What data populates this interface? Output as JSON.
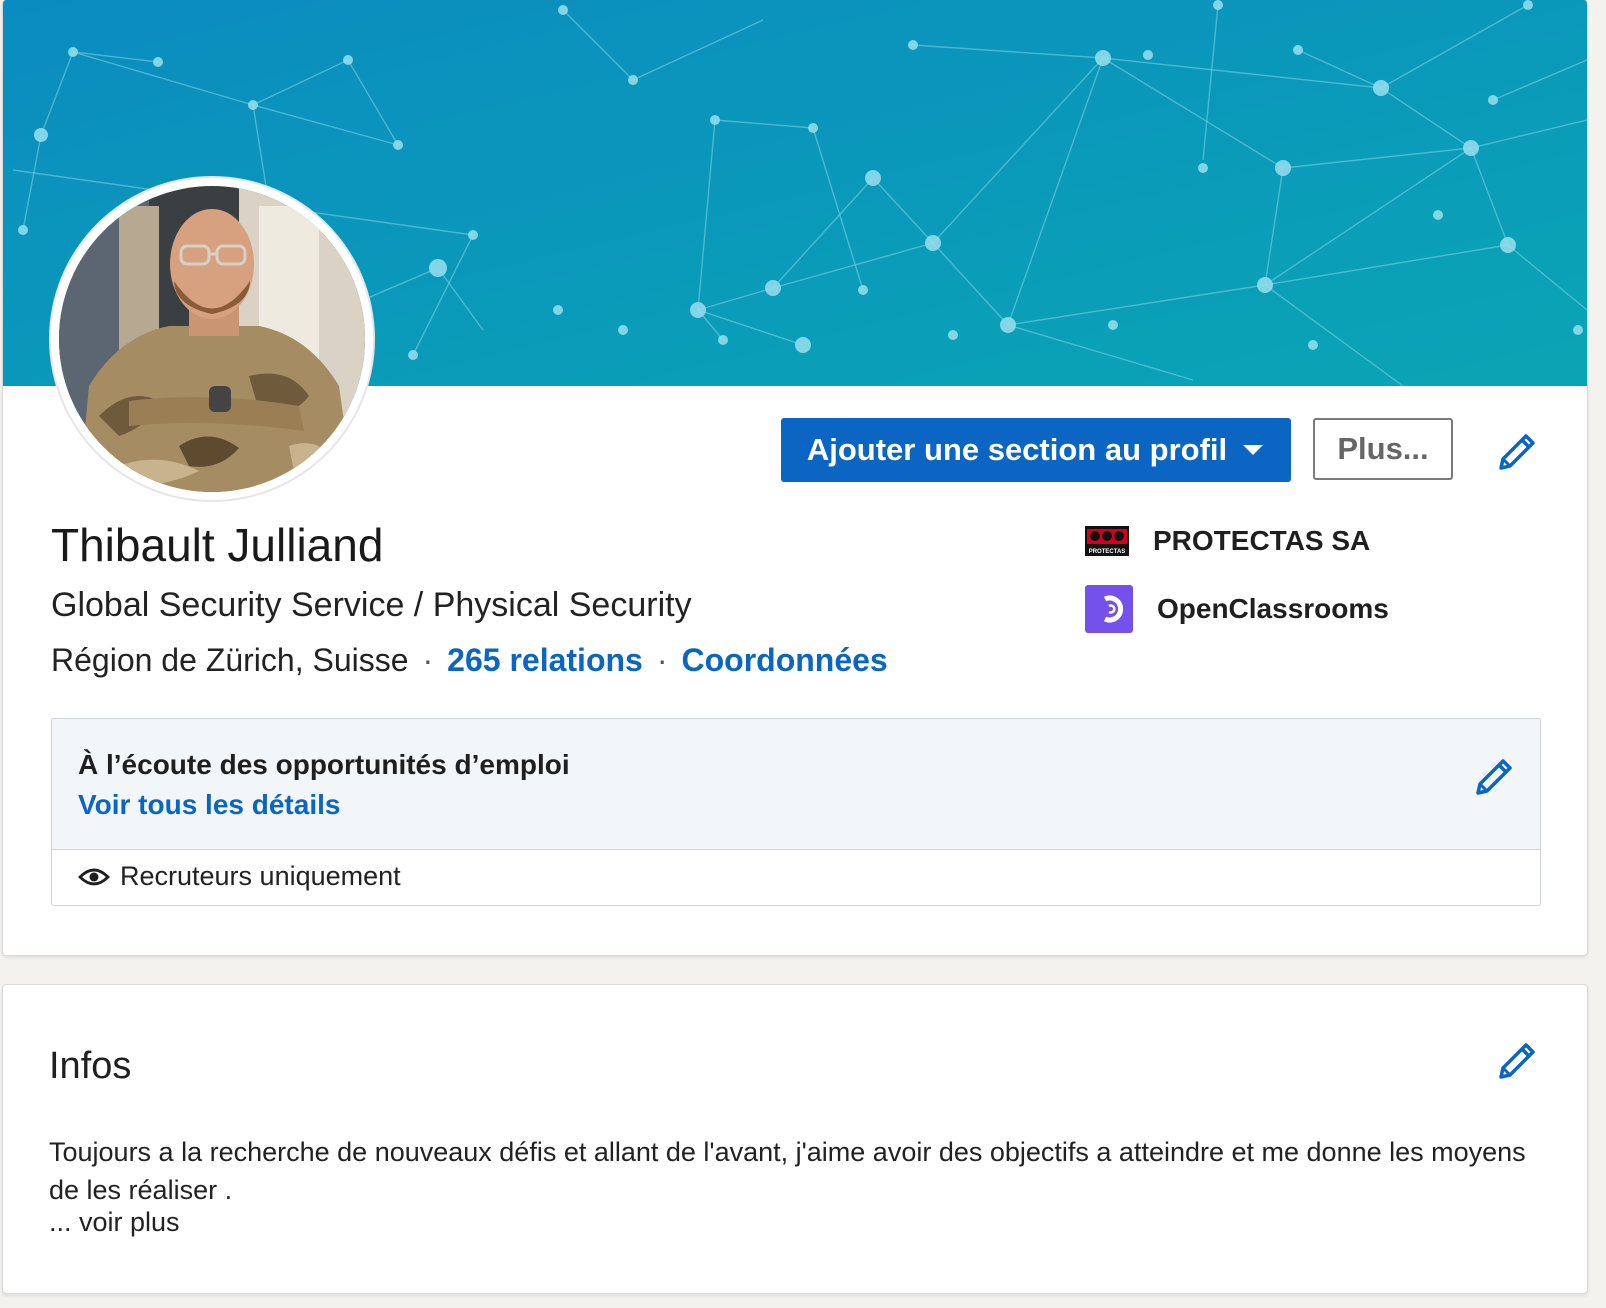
{
  "profile": {
    "name": "Thibault Julliand",
    "headline": "Global Security Service / Physical Security",
    "location": "Région de Zürich, Suisse",
    "connections": "265 relations",
    "contact_info": "Coordonnées",
    "separator": "·"
  },
  "actions": {
    "add_section": "Ajouter une section au profil",
    "more": "Plus..."
  },
  "companies": [
    {
      "name": "PROTECTAS SA",
      "logo_text": "PROTECTAS",
      "icon": "protectas-logo-icon"
    },
    {
      "name": "OpenClassrooms",
      "icon": "openclassrooms-logo-icon"
    }
  ],
  "open_to_work": {
    "title": "À l’écoute des opportunités d’emploi",
    "details_link": "Voir tous les détails",
    "visibility": "Recruteurs uniquement",
    "visibility_icon": "eye-icon"
  },
  "about": {
    "title": "Infos",
    "text": "Toujours a la recherche de nouveaux défis et allant de l'avant, j'aime avoir des objectifs a atteindre et me donne les moyens de les réaliser .",
    "see_more": "... voir plus"
  },
  "colors": {
    "accent": "#0a66c2",
    "banner_start": "#0a8fbf",
    "banner_end": "#0aa3b3",
    "openclassrooms": "#7451eb",
    "protectas": "#d6001c"
  }
}
